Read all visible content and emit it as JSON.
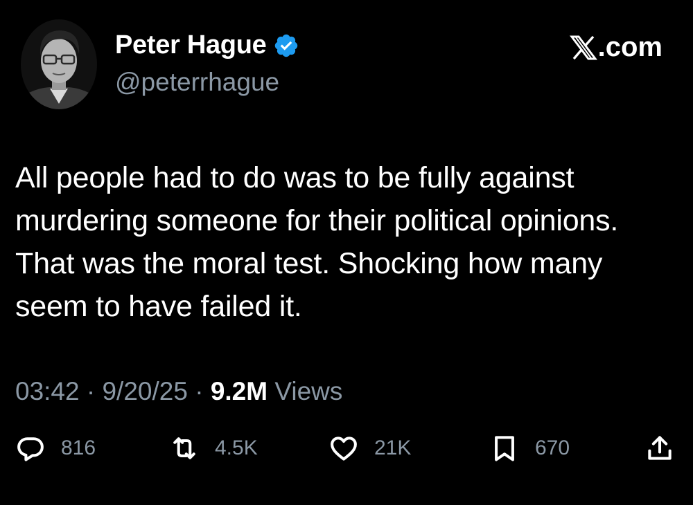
{
  "author": {
    "name": "Peter Hague",
    "handle": "@peterrhague",
    "verified": true,
    "avatar_icon": "profile-photo-avatar"
  },
  "brand": {
    "label": ".com",
    "icon": "x-logo-icon"
  },
  "tweet": {
    "text": "All people had to do was to be fully against murdering someone for their political opinions. That was the moral test. Shocking how many seem to have failed it."
  },
  "meta": {
    "time": "03:42",
    "separator": " · ",
    "date": "9/20/25",
    "views_count": "9.2M",
    "views_label": " Views"
  },
  "actions": {
    "replies": "816",
    "reposts": "4.5K",
    "likes": "21K",
    "bookmarks": "670"
  },
  "colors": {
    "background": "#000000",
    "text": "#ffffff",
    "secondary": "#8b98a5",
    "verified": "#1d9bf0"
  }
}
